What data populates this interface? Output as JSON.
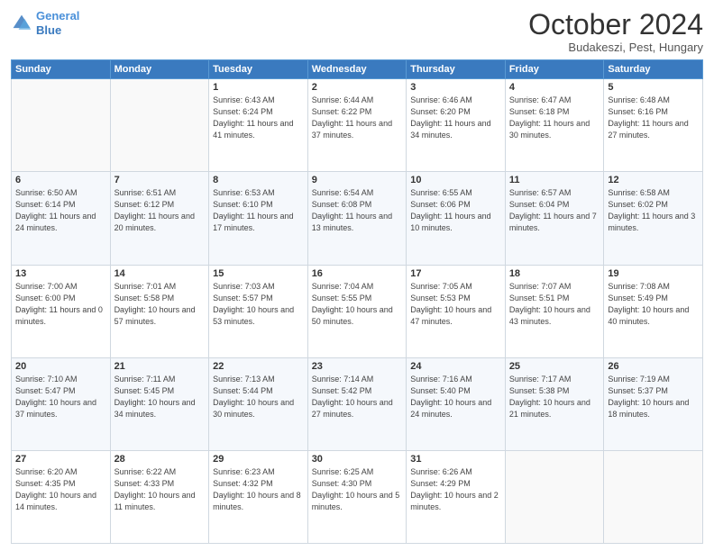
{
  "header": {
    "logo_line1": "General",
    "logo_line2": "Blue",
    "month": "October 2024",
    "location": "Budakeszi, Pest, Hungary"
  },
  "weekdays": [
    "Sunday",
    "Monday",
    "Tuesday",
    "Wednesday",
    "Thursday",
    "Friday",
    "Saturday"
  ],
  "weeks": [
    [
      {
        "day": "",
        "sunrise": "",
        "sunset": "",
        "daylight": ""
      },
      {
        "day": "",
        "sunrise": "",
        "sunset": "",
        "daylight": ""
      },
      {
        "day": "1",
        "sunrise": "Sunrise: 6:43 AM",
        "sunset": "Sunset: 6:24 PM",
        "daylight": "Daylight: 11 hours and 41 minutes."
      },
      {
        "day": "2",
        "sunrise": "Sunrise: 6:44 AM",
        "sunset": "Sunset: 6:22 PM",
        "daylight": "Daylight: 11 hours and 37 minutes."
      },
      {
        "day": "3",
        "sunrise": "Sunrise: 6:46 AM",
        "sunset": "Sunset: 6:20 PM",
        "daylight": "Daylight: 11 hours and 34 minutes."
      },
      {
        "day": "4",
        "sunrise": "Sunrise: 6:47 AM",
        "sunset": "Sunset: 6:18 PM",
        "daylight": "Daylight: 11 hours and 30 minutes."
      },
      {
        "day": "5",
        "sunrise": "Sunrise: 6:48 AM",
        "sunset": "Sunset: 6:16 PM",
        "daylight": "Daylight: 11 hours and 27 minutes."
      }
    ],
    [
      {
        "day": "6",
        "sunrise": "Sunrise: 6:50 AM",
        "sunset": "Sunset: 6:14 PM",
        "daylight": "Daylight: 11 hours and 24 minutes."
      },
      {
        "day": "7",
        "sunrise": "Sunrise: 6:51 AM",
        "sunset": "Sunset: 6:12 PM",
        "daylight": "Daylight: 11 hours and 20 minutes."
      },
      {
        "day": "8",
        "sunrise": "Sunrise: 6:53 AM",
        "sunset": "Sunset: 6:10 PM",
        "daylight": "Daylight: 11 hours and 17 minutes."
      },
      {
        "day": "9",
        "sunrise": "Sunrise: 6:54 AM",
        "sunset": "Sunset: 6:08 PM",
        "daylight": "Daylight: 11 hours and 13 minutes."
      },
      {
        "day": "10",
        "sunrise": "Sunrise: 6:55 AM",
        "sunset": "Sunset: 6:06 PM",
        "daylight": "Daylight: 11 hours and 10 minutes."
      },
      {
        "day": "11",
        "sunrise": "Sunrise: 6:57 AM",
        "sunset": "Sunset: 6:04 PM",
        "daylight": "Daylight: 11 hours and 7 minutes."
      },
      {
        "day": "12",
        "sunrise": "Sunrise: 6:58 AM",
        "sunset": "Sunset: 6:02 PM",
        "daylight": "Daylight: 11 hours and 3 minutes."
      }
    ],
    [
      {
        "day": "13",
        "sunrise": "Sunrise: 7:00 AM",
        "sunset": "Sunset: 6:00 PM",
        "daylight": "Daylight: 11 hours and 0 minutes."
      },
      {
        "day": "14",
        "sunrise": "Sunrise: 7:01 AM",
        "sunset": "Sunset: 5:58 PM",
        "daylight": "Daylight: 10 hours and 57 minutes."
      },
      {
        "day": "15",
        "sunrise": "Sunrise: 7:03 AM",
        "sunset": "Sunset: 5:57 PM",
        "daylight": "Daylight: 10 hours and 53 minutes."
      },
      {
        "day": "16",
        "sunrise": "Sunrise: 7:04 AM",
        "sunset": "Sunset: 5:55 PM",
        "daylight": "Daylight: 10 hours and 50 minutes."
      },
      {
        "day": "17",
        "sunrise": "Sunrise: 7:05 AM",
        "sunset": "Sunset: 5:53 PM",
        "daylight": "Daylight: 10 hours and 47 minutes."
      },
      {
        "day": "18",
        "sunrise": "Sunrise: 7:07 AM",
        "sunset": "Sunset: 5:51 PM",
        "daylight": "Daylight: 10 hours and 43 minutes."
      },
      {
        "day": "19",
        "sunrise": "Sunrise: 7:08 AM",
        "sunset": "Sunset: 5:49 PM",
        "daylight": "Daylight: 10 hours and 40 minutes."
      }
    ],
    [
      {
        "day": "20",
        "sunrise": "Sunrise: 7:10 AM",
        "sunset": "Sunset: 5:47 PM",
        "daylight": "Daylight: 10 hours and 37 minutes."
      },
      {
        "day": "21",
        "sunrise": "Sunrise: 7:11 AM",
        "sunset": "Sunset: 5:45 PM",
        "daylight": "Daylight: 10 hours and 34 minutes."
      },
      {
        "day": "22",
        "sunrise": "Sunrise: 7:13 AM",
        "sunset": "Sunset: 5:44 PM",
        "daylight": "Daylight: 10 hours and 30 minutes."
      },
      {
        "day": "23",
        "sunrise": "Sunrise: 7:14 AM",
        "sunset": "Sunset: 5:42 PM",
        "daylight": "Daylight: 10 hours and 27 minutes."
      },
      {
        "day": "24",
        "sunrise": "Sunrise: 7:16 AM",
        "sunset": "Sunset: 5:40 PM",
        "daylight": "Daylight: 10 hours and 24 minutes."
      },
      {
        "day": "25",
        "sunrise": "Sunrise: 7:17 AM",
        "sunset": "Sunset: 5:38 PM",
        "daylight": "Daylight: 10 hours and 21 minutes."
      },
      {
        "day": "26",
        "sunrise": "Sunrise: 7:19 AM",
        "sunset": "Sunset: 5:37 PM",
        "daylight": "Daylight: 10 hours and 18 minutes."
      }
    ],
    [
      {
        "day": "27",
        "sunrise": "Sunrise: 6:20 AM",
        "sunset": "Sunset: 4:35 PM",
        "daylight": "Daylight: 10 hours and 14 minutes."
      },
      {
        "day": "28",
        "sunrise": "Sunrise: 6:22 AM",
        "sunset": "Sunset: 4:33 PM",
        "daylight": "Daylight: 10 hours and 11 minutes."
      },
      {
        "day": "29",
        "sunrise": "Sunrise: 6:23 AM",
        "sunset": "Sunset: 4:32 PM",
        "daylight": "Daylight: 10 hours and 8 minutes."
      },
      {
        "day": "30",
        "sunrise": "Sunrise: 6:25 AM",
        "sunset": "Sunset: 4:30 PM",
        "daylight": "Daylight: 10 hours and 5 minutes."
      },
      {
        "day": "31",
        "sunrise": "Sunrise: 6:26 AM",
        "sunset": "Sunset: 4:29 PM",
        "daylight": "Daylight: 10 hours and 2 minutes."
      },
      {
        "day": "",
        "sunrise": "",
        "sunset": "",
        "daylight": ""
      },
      {
        "day": "",
        "sunrise": "",
        "sunset": "",
        "daylight": ""
      }
    ]
  ]
}
